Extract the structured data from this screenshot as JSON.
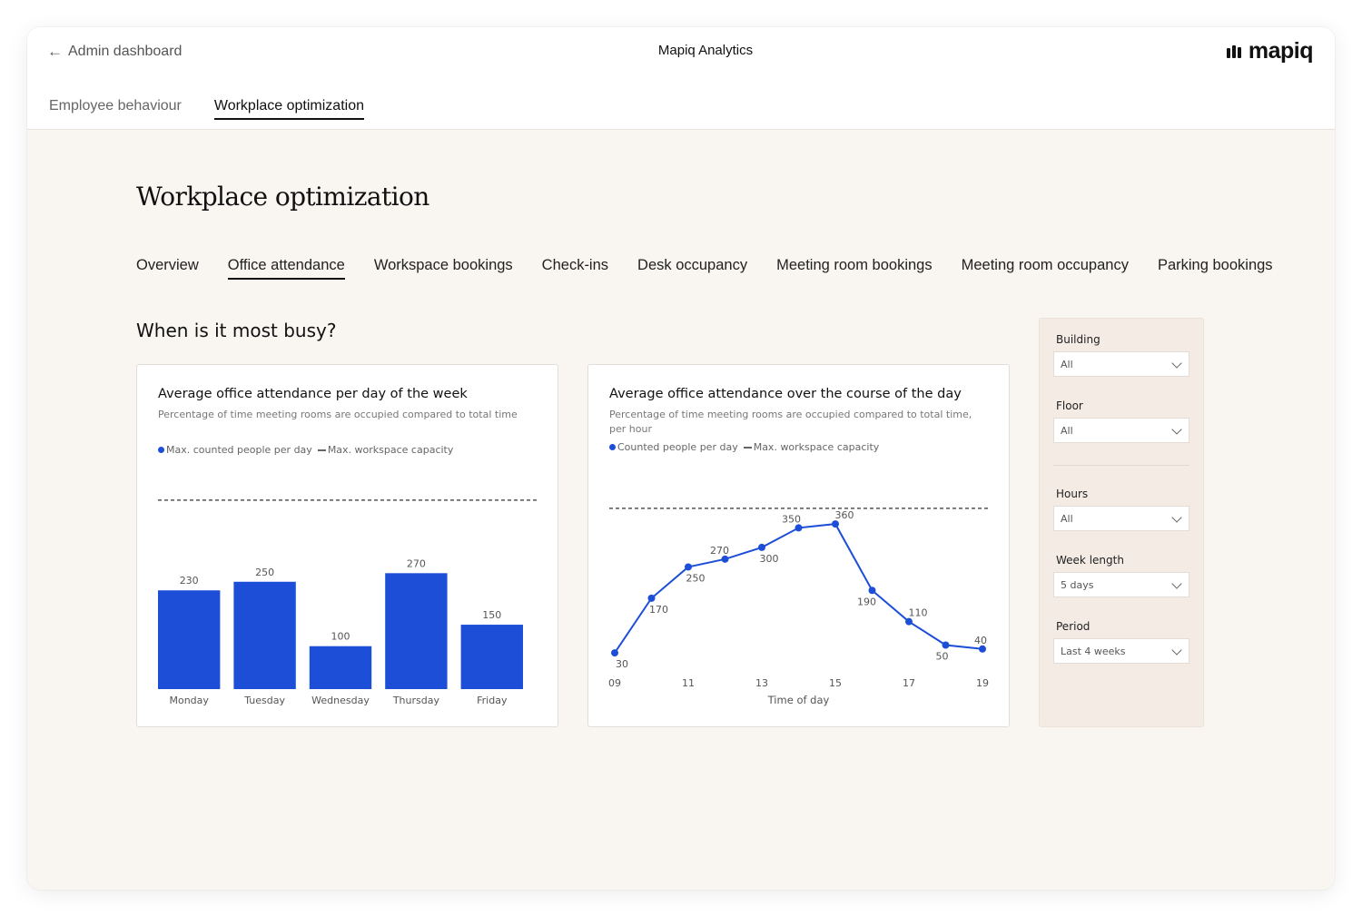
{
  "header": {
    "back_label": "Admin dashboard",
    "app_title": "Mapiq Analytics",
    "logo_text": "mapiq"
  },
  "top_tabs": [
    {
      "label": "Employee behaviour",
      "active": false
    },
    {
      "label": "Workplace optimization",
      "active": true
    }
  ],
  "page": {
    "title": "Workplace optimization",
    "sub_tabs": [
      {
        "label": "Overview",
        "active": false
      },
      {
        "label": "Office attendance",
        "active": true
      },
      {
        "label": "Workspace bookings",
        "active": false
      },
      {
        "label": "Check-ins",
        "active": false
      },
      {
        "label": "Desk occupancy",
        "active": false
      },
      {
        "label": "Meeting room bookings",
        "active": false
      },
      {
        "label": "Meeting room occupancy",
        "active": false
      },
      {
        "label": "Parking bookings",
        "active": false
      }
    ],
    "section_title": "When is it most busy?"
  },
  "cards": {
    "weekly": {
      "title": "Average office attendance per day of the week",
      "subtitle": "Percentage of time meeting rooms are occupied compared to total time",
      "legend_series": "Max. counted people per day",
      "legend_capacity": "Max. workspace capacity"
    },
    "daily": {
      "title": "Average office attendance over the course of the day",
      "subtitle": "Percentage of time meeting rooms are occupied compared to total time, per hour",
      "legend_series": "Counted people per day",
      "legend_capacity": "Max. workspace capacity",
      "xlabel": "Time of day"
    }
  },
  "chart_data": [
    {
      "type": "bar",
      "title": "Average office attendance per day of the week",
      "subtitle": "Percentage of time meeting rooms are occupied compared to total time",
      "categories": [
        "Monday",
        "Tuesday",
        "Wednesday",
        "Thursday",
        "Friday"
      ],
      "series": [
        {
          "name": "Max. counted people per day",
          "values": [
            230,
            250,
            100,
            270,
            150
          ]
        }
      ],
      "capacity_line": {
        "name": "Max. workspace capacity",
        "value": 440
      },
      "ylim": [
        0,
        480
      ],
      "data_labels": true,
      "grid": false,
      "legend": "top-left",
      "colors": {
        "bar": "#1d4ed8",
        "capacity": "#555555"
      }
    },
    {
      "type": "line",
      "title": "Average office attendance over the course of the day",
      "subtitle": "Percentage of time meeting rooms are occupied compared to total time, per hour",
      "xlabel": "Time of day",
      "x": [
        9,
        10,
        11,
        12,
        13,
        14,
        15,
        16,
        17,
        18,
        19
      ],
      "x_tick_labels": [
        "09",
        "11",
        "13",
        "15",
        "17",
        "19"
      ],
      "x_tick_values": [
        9,
        11,
        13,
        15,
        17,
        19
      ],
      "series": [
        {
          "name": "Counted people per day",
          "values": [
            30,
            170,
            250,
            270,
            300,
            350,
            360,
            190,
            110,
            50,
            40
          ]
        }
      ],
      "capacity_line": {
        "name": "Max. workspace capacity",
        "value": 400
      },
      "ylim": [
        0,
        430
      ],
      "data_labels": true,
      "grid": false,
      "legend": "top-left",
      "colors": {
        "line": "#1d4ed8",
        "capacity": "#555555"
      }
    }
  ],
  "filters": [
    {
      "label": "Building",
      "value": "All"
    },
    {
      "label": "Floor",
      "value": "All"
    },
    {
      "label": "Hours",
      "value": "All"
    },
    {
      "label": "Week length",
      "value": "5 days"
    },
    {
      "label": "Period",
      "value": "Last 4 weeks"
    }
  ]
}
